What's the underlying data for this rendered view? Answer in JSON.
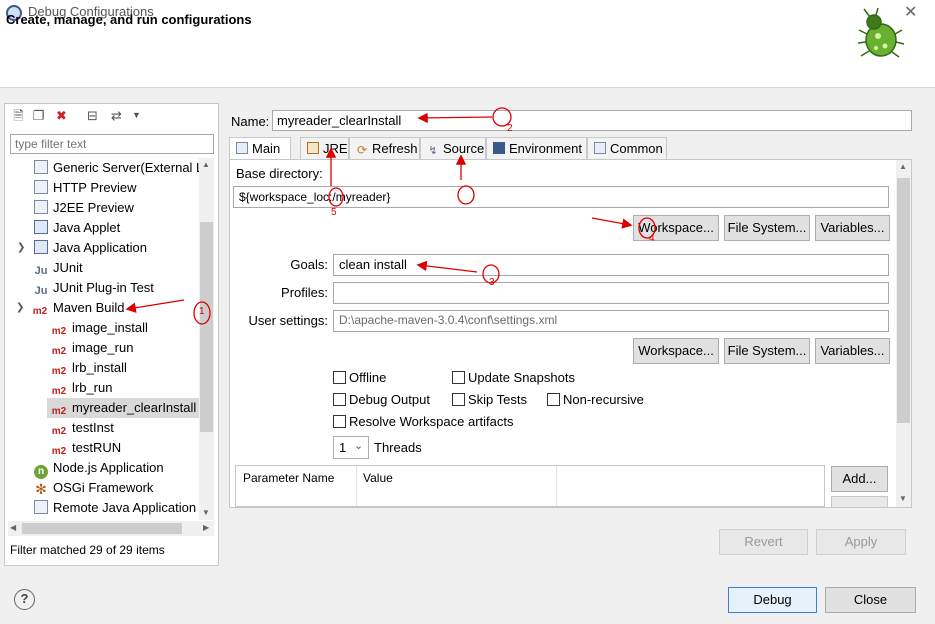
{
  "window": {
    "title": "Debug Configurations",
    "close_glyph": "✕",
    "icon": "eclipse-icon"
  },
  "header": {
    "title": "Create, manage, and run configurations",
    "logo": "debug-bug-icon",
    "logo_color": "#5a9a2a"
  },
  "left": {
    "toolbar_icons": [
      "new-config-icon",
      "duplicate-icon",
      "delete-icon",
      "collapse-all-icon",
      "filter-icon",
      "dropdown-icon"
    ],
    "filter_placeholder": "type filter text",
    "status": "Filter matched 29 of 29 items",
    "tree": [
      {
        "label": "Generic Server(External L",
        "icon": "server-icon"
      },
      {
        "label": "HTTP Preview",
        "icon": "server-icon"
      },
      {
        "label": "J2EE Preview",
        "icon": "server-icon"
      },
      {
        "label": "Java Applet",
        "icon": "java-applet-icon"
      },
      {
        "label": "Java Application",
        "icon": "java-app-icon"
      },
      {
        "label": "JUnit",
        "icon": "junit-icon"
      },
      {
        "label": "JUnit Plug-in Test",
        "icon": "junit-plugin-icon"
      },
      {
        "label": "Maven Build",
        "icon": "m2-icon"
      },
      {
        "label": "image_install",
        "icon": "m2-icon"
      },
      {
        "label": "image_run",
        "icon": "m2-icon"
      },
      {
        "label": "lrb_install",
        "icon": "m2-icon"
      },
      {
        "label": "lrb_run",
        "icon": "m2-icon"
      },
      {
        "label": "myreader_clearInstall",
        "icon": "m2-icon"
      },
      {
        "label": "testInst",
        "icon": "m2-icon"
      },
      {
        "label": "testRUN",
        "icon": "m2-icon"
      },
      {
        "label": "Node.js Application",
        "icon": "nodejs-icon"
      },
      {
        "label": "OSGi Framework",
        "icon": "osgi-icon"
      },
      {
        "label": "Remote Java Application",
        "icon": "remote-java-icon"
      }
    ],
    "m2_text": "m2",
    "ju_text": "Ju",
    "n_text": "n"
  },
  "config": {
    "name_label": "Name:",
    "name_value": "myreader_clearInstall",
    "tabs": [
      {
        "label": "Main",
        "icon": "main-tab-icon"
      },
      {
        "label": "JRE",
        "icon": "jre-icon"
      },
      {
        "label": "Refresh",
        "icon": "refresh-icon"
      },
      {
        "label": "Source",
        "icon": "source-icon"
      },
      {
        "label": "Environment",
        "icon": "environment-icon"
      },
      {
        "label": "Common",
        "icon": "common-icon"
      }
    ],
    "base_dir_label": "Base directory:",
    "base_dir_value": "${workspace_loc:/myreader}",
    "btn_workspace": "Workspace...",
    "btn_filesystem": "File System...",
    "btn_variables": "Variables...",
    "goals_label": "Goals:",
    "goals_value": "clean install",
    "profiles_label": "Profiles:",
    "profiles_value": "",
    "user_settings_label": "User settings:",
    "user_settings_value": "D:\\apache-maven-3.0.4\\conf\\settings.xml",
    "checkboxes": {
      "offline": "Offline",
      "update_snapshots": "Update Snapshots",
      "debug_output": "Debug Output",
      "skip_tests": "Skip Tests",
      "non_recursive": "Non-recursive",
      "resolve_workspace": "Resolve Workspace artifacts"
    },
    "threads_value": "1",
    "threads_label": "Threads",
    "param_col_name": "Parameter Name",
    "param_col_value": "Value",
    "add_button": "Add...",
    "revert_button": "Revert",
    "apply_button": "Apply"
  },
  "footer": {
    "debug_button": "Debug",
    "close_button": "Close",
    "help_glyph": "?"
  },
  "annotations": {
    "numbers": [
      "1",
      "2",
      "3",
      "4",
      "5"
    ],
    "color": "#dd0000"
  }
}
